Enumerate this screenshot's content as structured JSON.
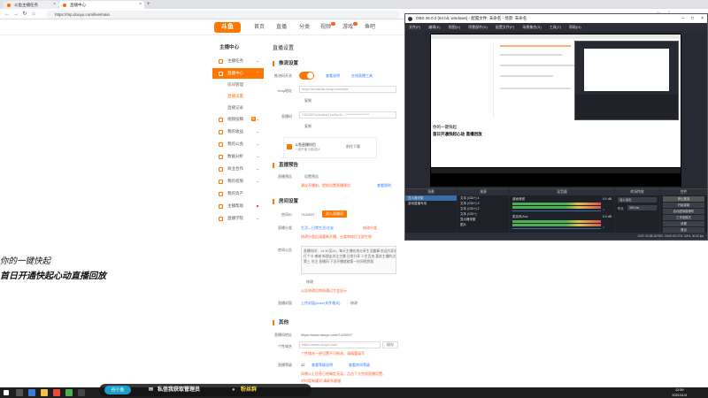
{
  "browser": {
    "tabs": [
      {
        "label": "斗鱼主播任务"
      },
      {
        "label": "直播中心"
      }
    ],
    "url": "https://mp.douyu.com/live/main"
  },
  "site": {
    "logo": "斗鱼",
    "nav": [
      "首页",
      "直播",
      "分类",
      "视频",
      "游戏",
      "鱼吧"
    ]
  },
  "sidebar": {
    "title": "主播中心",
    "items": [
      {
        "label": "主播任务"
      },
      {
        "label": "直播中心"
      },
      {
        "label": "房间管理"
      },
      {
        "label": "直播设置"
      },
      {
        "label": "直播记录"
      },
      {
        "label": "视频投稿",
        "badge": "新"
      },
      {
        "label": "我的收益"
      },
      {
        "label": "我的公会"
      },
      {
        "label": "数据分析"
      },
      {
        "label": "商业合作"
      },
      {
        "label": "我的权限"
      },
      {
        "label": "我的资产"
      },
      {
        "label": "主播帮助"
      },
      {
        "label": "直播学院"
      }
    ]
  },
  "main": {
    "page_title": "直播设置",
    "sec_push": "推流设置",
    "push_label": "推流码开关",
    "push_link1": "查看说明",
    "push_link2": "在线直播工具",
    "rtmp_label": "rtmp地址",
    "rtmp_value": "rtmp://sendtc3a.douyu.com/live",
    "copy": "复制",
    "key_label": "直播码",
    "key_value": "7420097rUxcAvdY7wSz=&…******************",
    "promo_title": "斗鱼直播伴侣",
    "promo_sub": "一键开播 功能强大",
    "promo_btn": "前往下载",
    "sec_notice": "直播预告",
    "notice_label": "直播预告",
    "notice_btn": "设置预告",
    "notice_warn": "建议开播前，提前设置直播预告",
    "notice_link": "查看规则",
    "sec_room": "房间设置",
    "room_id_label": "房间ID",
    "room_id": "7420097",
    "room_id_btn": "进入直播间",
    "room_cat_label": "直播分类",
    "room_cat": "生活—日常生活/交友",
    "room_cat_link": "修改分类",
    "room_cat_warn": "修改分类后请重新开播，分类审核后立即生效",
    "room_notice_label": "房间公告",
    "room_notice": "直播时间：14:30至24，每天主播在线分享生活趣事 欢迎大家来直播间",
    "room_notice2": "打个卡 感谢 新朋友关注主播 日常分享 人生百态 喜欢主播的点个关注吧",
    "room_notice3": "第三 关注 直播间 下次开播就能第一时间找到我",
    "edit": "修改",
    "room_notice_warn": "公告修改后审核通过才会显示",
    "room_pic_label": "直播封面",
    "room_pic_link": "上传封面(cover文件格式)",
    "room_pic_btn": "修改",
    "sec_other": "其他",
    "link_label": "直播间地址",
    "link_value": "https://www.douyu.com/7420097",
    "mobile_label": "个性域名",
    "mobile_value": "https://www.douyu.com/",
    "mobile_btn": "保存",
    "mobile_warn": "个性域名一经设置不可修改，请慎重填写",
    "level_label": "直播等级",
    "level_value": "12",
    "level_link": "查看等级说明",
    "level_link2": "查看房间等级",
    "bottom_warn": "如果以上信息已经确定无误，点击下方完成直播设置，",
    "bottom_warn2": "对内容有疑问 请联系客服"
  },
  "obs": {
    "title": "OBS 26.0.2 (64 bit, windows) - 配置文件: 未命名 - 场景: 未命名",
    "menu": [
      "文件(F)",
      "编辑(E)",
      "视图(V)",
      "停靠部件(D)",
      "配置文件(P)",
      "场景集合(S)",
      "工具(T)",
      "帮助(H)"
    ],
    "preview_text1": "你的一键快起",
    "preview_text2": "首日开通快起心动 直播回放",
    "scenes_title": "场景",
    "scenes": [
      "显示器采集",
      "游戏直播专用"
    ],
    "sources_title": "来源",
    "sources": [
      "文本 (GDI+) 4",
      "文本 (GDI+) 3",
      "文本 (GDI+) 2",
      "文本 (GDI+)",
      "显示器采集",
      "图片"
    ],
    "mixer_title": "混音器",
    "mixer": [
      {
        "name": "桌面音频",
        "db": "0.0 dB"
      },
      {
        "name": "麦克风/Aux",
        "db": "0.0 dB"
      }
    ],
    "transition_title": "转场特效",
    "transition_value": "淡入淡出",
    "duration_label": "时长",
    "duration_value": "300 ms",
    "controls_title": "控件",
    "controls": [
      "停止推流",
      "开始录制",
      "启动虚拟摄像机",
      "工作室模式",
      "设置",
      "退出"
    ],
    "status": "LIVE: 00:38:18   REC: 00:00:00   CPU: 3.8%, 30.00 fps"
  },
  "overlay": {
    "line1": "你的一键快起",
    "line2": "首日开通快起心动直播回放"
  },
  "banner": {
    "name": "谷小鱼",
    "text": "私信我获取管理员",
    "group": "粉丝群"
  },
  "taskbar": {
    "time": "12:59",
    "date": "2021/11/3"
  }
}
